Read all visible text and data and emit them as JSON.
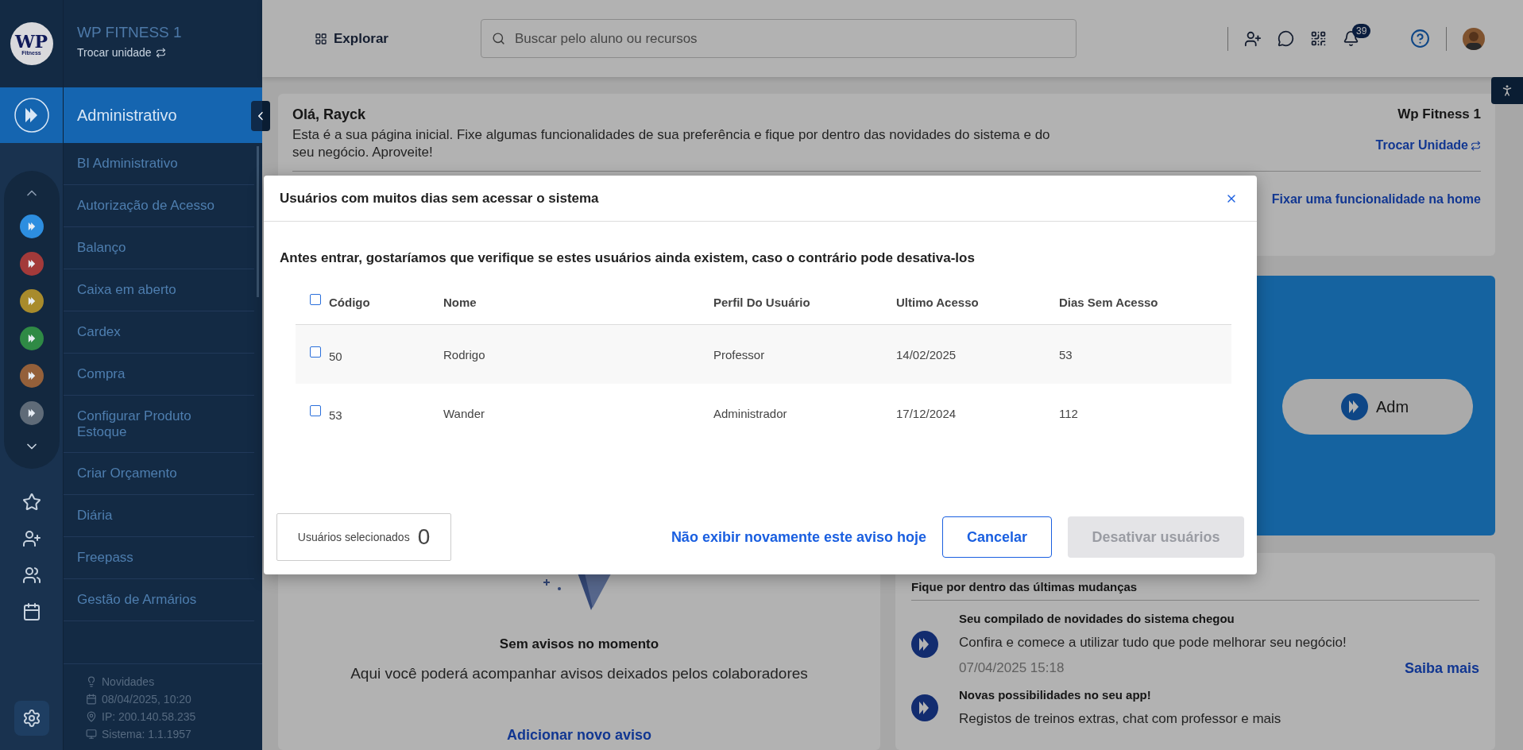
{
  "rail": {
    "logo_text": "WP",
    "logo_subtext": "Fitness",
    "modules": [
      {
        "color": "#2d8ee0"
      },
      {
        "color": "#a33a3a"
      },
      {
        "color": "#a88b2c"
      },
      {
        "color": "#2f8a45"
      },
      {
        "color": "#94603a"
      },
      {
        "color": "#5f6b78"
      }
    ]
  },
  "sidebar": {
    "brand": "WP FITNESS 1",
    "switch_unit": "Trocar unidade",
    "section": "Administrativo",
    "items": [
      "BI Administrativo",
      "Autorização de Acesso",
      "Balanço",
      "Caixa em aberto",
      "Cardex",
      "Compra",
      "Configurar Produto Estoque",
      "Criar Orçamento",
      "Diária",
      "Freepass",
      "Gestão de Armários"
    ],
    "footer": [
      {
        "kind": "news",
        "text": "Novidades"
      },
      {
        "kind": "date",
        "text": "08/04/2025, 10:20"
      },
      {
        "kind": "ip",
        "text": "IP: 200.140.58.235"
      },
      {
        "kind": "system",
        "text": "Sistema: 1.1.1957"
      }
    ]
  },
  "topbar": {
    "explore": "Explorar",
    "search_placeholder": "Buscar pelo aluno ou recursos",
    "notifications": "39"
  },
  "welcome": {
    "greeting": "Olá, Rayck",
    "text": "Esta é a sua página inicial. Fixe algumas funcionalidades de sua preferência e fique por dentro das novidades do sistema e do seu negócio. Aproveite!",
    "unit": "Wp Fitness 1",
    "switch_unit": "Trocar Unidade",
    "pin": "Fixar uma funcionalidade na home"
  },
  "banner": {
    "label": "Adm"
  },
  "notices": {
    "title": "Sem avisos no momento",
    "text": "Aqui você poderá acompanhar avisos deixados pelos colaboradores",
    "add": "Adicionar novo aviso"
  },
  "news": {
    "title": "Fique por dentro das últimas mudanças",
    "items": [
      {
        "title": "Seu compilado de novidades do sistema chegou",
        "text": "Confira e comece a utilizar tudo que pode melhorar seu negócio!",
        "date": "07/04/2025 15:18",
        "link": "Saiba mais"
      },
      {
        "title": "Novas possibilidades no seu app!",
        "text": "Registos de treinos extras, chat com professor e mais"
      }
    ]
  },
  "modal": {
    "title": "Usuários com muitos dias sem acessar o sistema",
    "intro": "Antes entrar, gostaríamos que verifique se estes usuários ainda existem, caso o contrário pode desativa-los",
    "all_checked": false,
    "columns": [
      "Código",
      "Nome",
      "Perfil Do Usuário",
      "Ultimo Acesso",
      "Dias Sem Acesso"
    ],
    "rows": [
      {
        "checked": false,
        "cells": [
          "50",
          "Rodrigo",
          "Professor",
          "14/02/2025",
          "53"
        ]
      },
      {
        "checked": false,
        "cells": [
          "53",
          "Wander",
          "Administrador",
          "17/12/2024",
          "112"
        ]
      }
    ],
    "selected_label": "Usuários selecionados",
    "selected_count": "0",
    "dont_show": "Não exibir novamente este aviso hoje",
    "cancel": "Cancelar",
    "deactivate": {
      "label": "Desativar usuários",
      "disabled": true
    }
  }
}
